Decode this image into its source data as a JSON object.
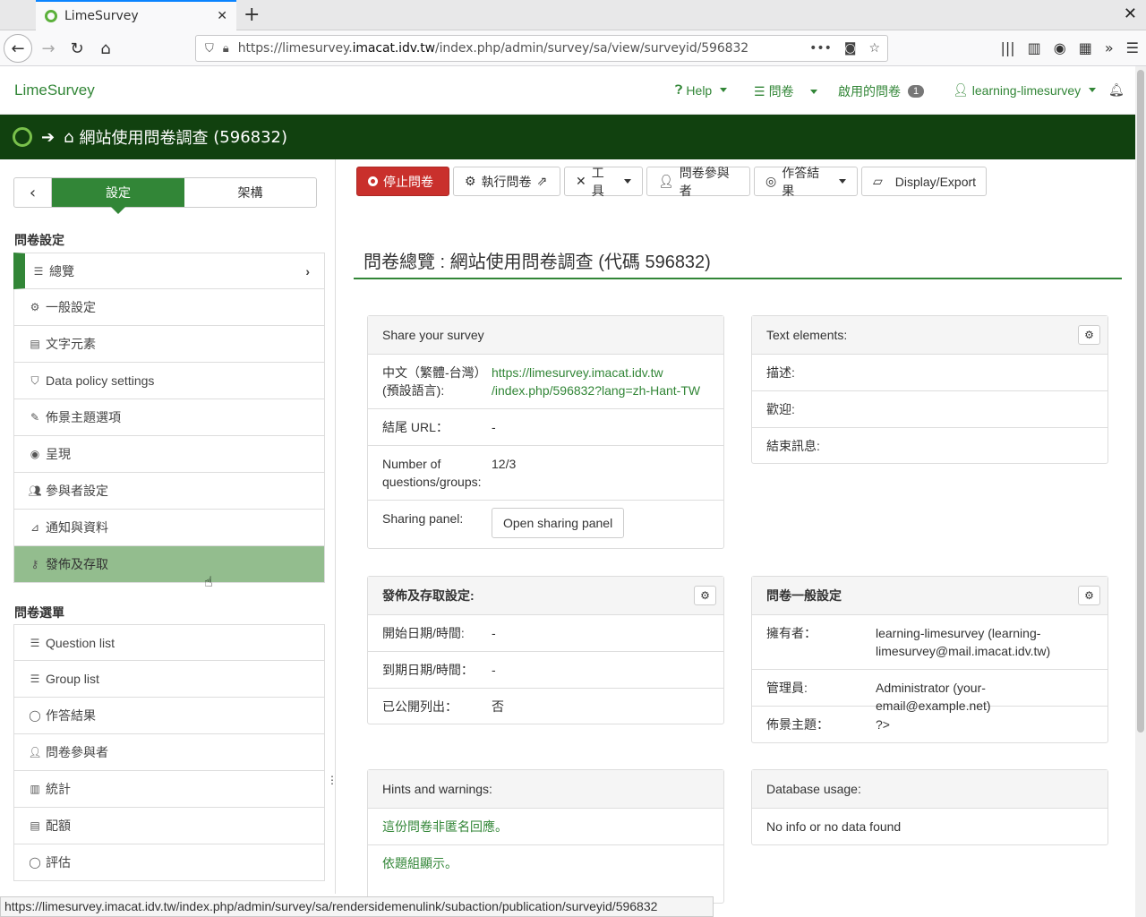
{
  "browser": {
    "tab_title": "LimeSurvey",
    "url_prefix": "https://limesurvey.",
    "url_domain": "imacat.idv.tw",
    "url_path": "/index.php/admin/survey/sa/view/surveyid/596832",
    "status_url": "https://limesurvey.imacat.idv.tw/index.php/admin/survey/sa/rendersidemenulink/subaction/publication/surveyid/596832"
  },
  "header": {
    "brand": "LimeSurvey",
    "help": "Help",
    "surveys": "問卷",
    "active_surveys": "啟用的問卷",
    "active_count": "1",
    "user": "learning-limesurvey"
  },
  "surveybar": {
    "title": "網站使用問卷調查",
    "id": "(596832)"
  },
  "sidebar": {
    "tab_settings": "設定",
    "tab_structure": "架構",
    "section_settings": "問卷設定",
    "settings_items": [
      {
        "label": "總覽",
        "icon": "list-icon"
      },
      {
        "label": "一般設定",
        "icon": "gears-icon"
      },
      {
        "label": "文字元素",
        "icon": "file-icon"
      },
      {
        "label": "Data policy settings",
        "icon": "shield-icon"
      },
      {
        "label": "佈景主題選項",
        "icon": "paintbrush-icon"
      },
      {
        "label": "呈現",
        "icon": "eye-icon"
      },
      {
        "label": "參與者設定",
        "icon": "users-icon"
      },
      {
        "label": "通知與資料",
        "icon": "rss-icon"
      },
      {
        "label": "發佈及存取",
        "icon": "key-icon"
      }
    ],
    "section_menu": "問卷選單",
    "menu_items": [
      {
        "label": "Question list",
        "icon": "list-icon"
      },
      {
        "label": "Group list",
        "icon": "list-icon"
      },
      {
        "label": "作答結果",
        "icon": "comment-icon"
      },
      {
        "label": "問卷參與者",
        "icon": "user-icon"
      },
      {
        "label": "統計",
        "icon": "bar-chart-icon"
      },
      {
        "label": "配額",
        "icon": "quota-icon"
      },
      {
        "label": "評估",
        "icon": "comment-icon"
      }
    ]
  },
  "toolbar": {
    "stop": "停止問卷",
    "execute": "執行問卷",
    "tools": "工具",
    "participants": "問卷參與者",
    "responses": "作答結果",
    "display_export": "Display/Export"
  },
  "main": {
    "title_prefix": "問卷總覽 : ",
    "title_name": "網站使用問卷調查",
    "title_code": " (代碼 596832)"
  },
  "share_panel": {
    "title": "Share your survey",
    "lang_label": "中文（繁體-台灣）(預設語言):",
    "lang_link_1": "https://limesurvey.imacat.idv.tw",
    "lang_link_2": "/index.php/596832?lang=zh-Hant-TW",
    "end_url_label": "結尾 URL：",
    "end_url_value": "-",
    "count_label": "Number of questions/groups:",
    "count_value": "12/3",
    "sharing_label": "Sharing panel:",
    "sharing_button": "Open sharing panel"
  },
  "text_panel": {
    "title": "Text elements:",
    "description": "描述:",
    "welcome": "歡迎:",
    "end_message": "結束訊息:"
  },
  "publish_panel": {
    "title": "發佈及存取設定:",
    "start_label": "開始日期/時間:",
    "start_value": "-",
    "expiry_label": "到期日期/時間：",
    "expiry_value": "-",
    "public_label": "已公開列出：",
    "public_value": "否"
  },
  "general_panel": {
    "title": "問卷一般設定",
    "owner_label": "擁有者：",
    "owner_value": "learning-limesurvey (learning-limesurvey@mail.imacat.idv.tw)",
    "admin_label": "管理員:",
    "admin_value": "Administrator (your-email@example.net)",
    "theme_label": "佈景主題：",
    "theme_value": "?>"
  },
  "hints_panel": {
    "title": "Hints and warnings:",
    "hint1": "這份問卷非匿名回應。",
    "hint2": "依題組顯示。"
  },
  "db_panel": {
    "title": "Database usage:",
    "value": "No info or no data found"
  },
  "colors": {
    "brand_green": "#328637",
    "dark_green": "#11410f",
    "danger": "#c9302c",
    "hover_green": "#93bd8e"
  }
}
